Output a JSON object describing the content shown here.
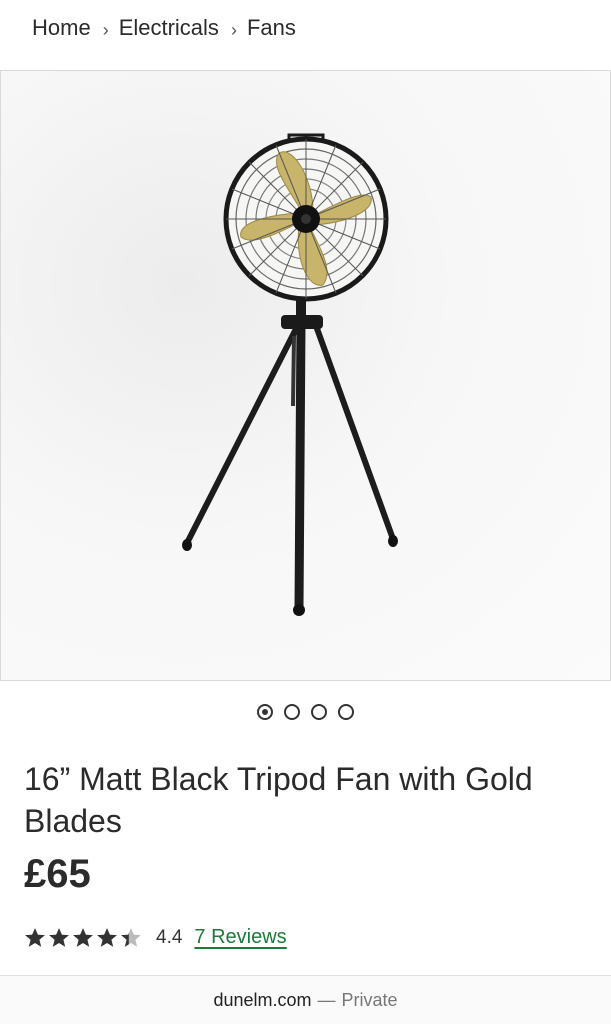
{
  "breadcrumb": {
    "items": [
      "Home",
      "Electricals",
      "Fans"
    ],
    "separator": "›"
  },
  "gallery": {
    "image_alt": "16” Matt Black Tripod Fan with Gold Blades",
    "slide_count": 4,
    "active_slide": 1
  },
  "product": {
    "title": "16” Matt Black Tripod Fan with Gold Blades",
    "price": "£65",
    "rating": {
      "value": "4.4",
      "stars": 4.4,
      "max": 5,
      "reviews_label": "7 Reviews"
    }
  },
  "browser": {
    "domain": "dunelm.com",
    "separator": "—",
    "mode": "Private"
  },
  "colors": {
    "review_link": "#1d7a3a",
    "star_fill": "#333333",
    "star_empty": "#bbbbbb"
  }
}
